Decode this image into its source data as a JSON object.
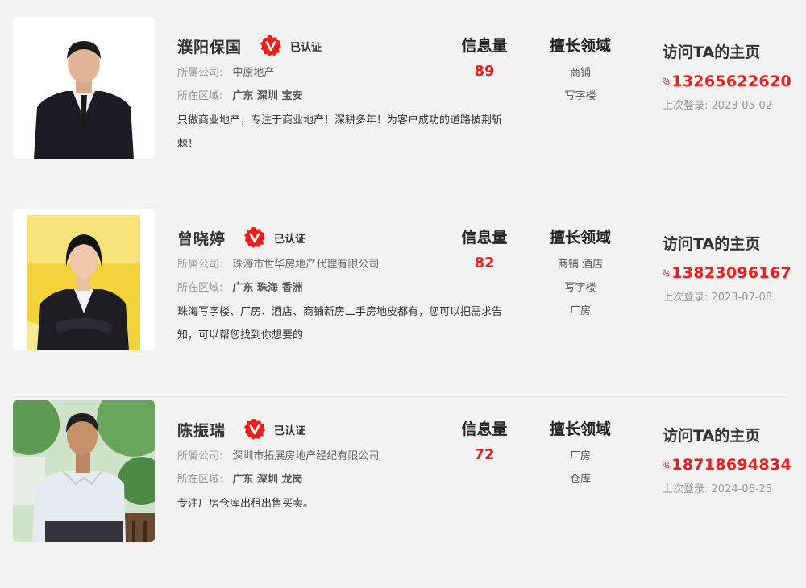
{
  "labels": {
    "company": "所属公司:",
    "region": "所在区域:",
    "verified": "已认证",
    "info_count": "信息量",
    "expertise": "擅长领域",
    "homepage": "访问TA的主页",
    "last_login": "上次登录:"
  },
  "colors": {
    "accent": "#e8201e",
    "background": "#f2f2f2"
  },
  "agents": [
    {
      "name": "濮阳保国",
      "company": "中原地产",
      "region": "广东 深圳 宝安",
      "description": "只做商业地产，专注于商业地产！深耕多年！为客户成功的道路披荆斩棘！",
      "info_count": "89",
      "expertise": [
        "商铺",
        "写字楼"
      ],
      "phone": "13265622620",
      "last_login": "2023-05-02"
    },
    {
      "name": "曾晓婷",
      "company": "珠海市世华房地产代理有限公司",
      "region": "广东 珠海 香洲",
      "description": "珠海写字楼、厂房、酒店、商铺新房二手房地皮都有，您可以把需求告知，可以帮您找到你想要的",
      "info_count": "82",
      "expertise": [
        "商铺 酒店",
        "写字楼",
        "厂房"
      ],
      "phone": "13823096167",
      "last_login": "2023-07-08"
    },
    {
      "name": "陈振瑞",
      "company": "深圳市拓展房地产经纪有限公司",
      "region": "广东 深圳 龙岗",
      "description": "专注厂房仓库出租出售买卖。",
      "info_count": "72",
      "expertise": [
        "厂房",
        "仓库"
      ],
      "phone": "18718694834",
      "last_login": "2024-06-25"
    }
  ]
}
